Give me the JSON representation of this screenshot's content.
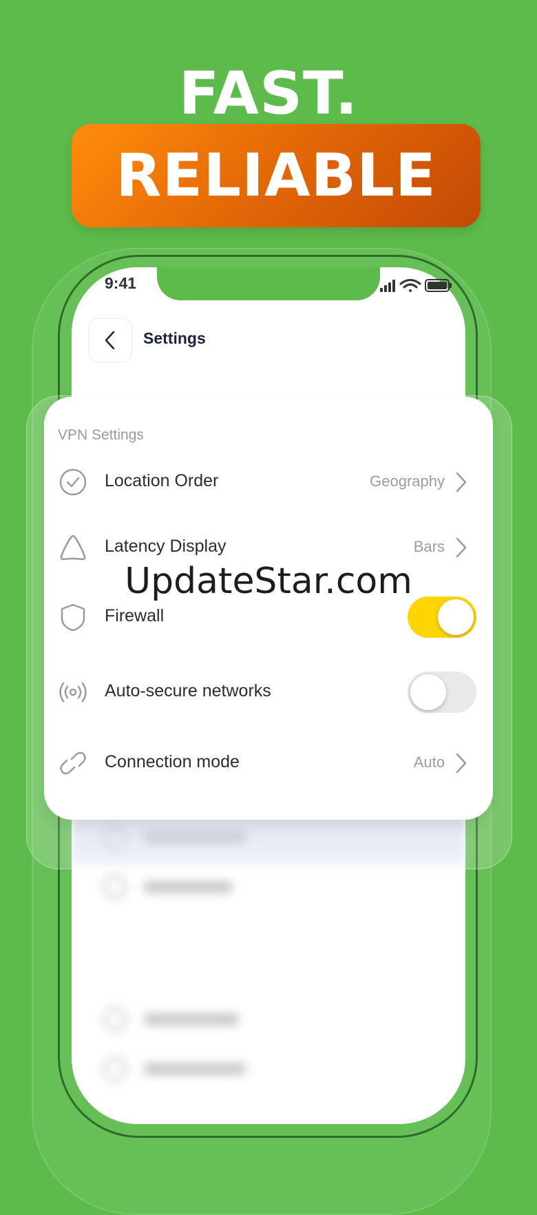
{
  "promo": {
    "line1": "FAST.",
    "line2": "RELIABLE"
  },
  "status_bar": {
    "time": "9:41",
    "icons": [
      "signal-icon",
      "wifi-icon",
      "battery-icon"
    ]
  },
  "header": {
    "title": "Settings",
    "back_icon": "chevron-left-icon"
  },
  "vpn_settings": {
    "section_label": "VPN Settings",
    "rows": [
      {
        "label": "Location Order",
        "value": "Geography",
        "icon": "shield-check-icon",
        "control": "chevron"
      },
      {
        "label": "Latency Display",
        "value": "Bars",
        "icon": "triangle-icon",
        "control": "chevron"
      },
      {
        "label": "Firewall",
        "icon": "shield-icon",
        "control": "toggle",
        "on": true
      },
      {
        "label": "Auto-secure networks",
        "icon": "broadcast-icon",
        "control": "toggle",
        "on": false
      },
      {
        "label": "Connection mode",
        "value": "Auto",
        "icon": "link-icon",
        "control": "chevron"
      }
    ]
  },
  "watermark": "UpdateStar.com",
  "colors": {
    "background": "#5cbb4b",
    "badge": "#e56a07",
    "toggle_on": "#ffd500",
    "title_text": "#1b2340"
  }
}
